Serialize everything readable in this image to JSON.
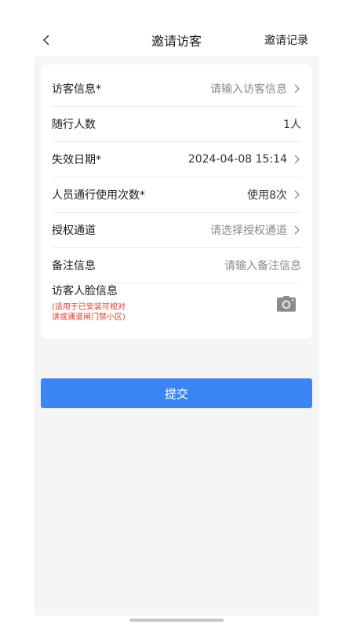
{
  "header": {
    "title": "邀请访客",
    "right_link": "邀请记录"
  },
  "form": {
    "rows": [
      {
        "label": "访客信息*",
        "value": "请输入访客信息",
        "placeholder": true,
        "chevron": true
      },
      {
        "label": "随行人数",
        "value": "1人",
        "placeholder": false,
        "chevron": false
      },
      {
        "label": "失效日期*",
        "value": "2024-04-08 15:14",
        "placeholder": false,
        "chevron": true
      },
      {
        "label": "人员通行使用次数*",
        "value": "使用8次",
        "placeholder": false,
        "chevron": true
      },
      {
        "label": "授权通道",
        "value": "请选择授权通道",
        "placeholder": true,
        "chevron": true
      },
      {
        "label": "备注信息",
        "value": "请输入备注信息",
        "placeholder": true,
        "chevron": false
      }
    ],
    "face": {
      "label": "访客人脸信息",
      "note": "(适用于已安装可视对讲或通道闸门禁小区)"
    }
  },
  "submit_label": "提交",
  "colors": {
    "accent": "#3b85f4",
    "warning_text": "#e03a2f",
    "page_bg": "#f5f5f5"
  },
  "icons": {
    "back": "chevron-left-icon",
    "row_arrow": "chevron-right-icon",
    "camera": "camera-icon"
  }
}
